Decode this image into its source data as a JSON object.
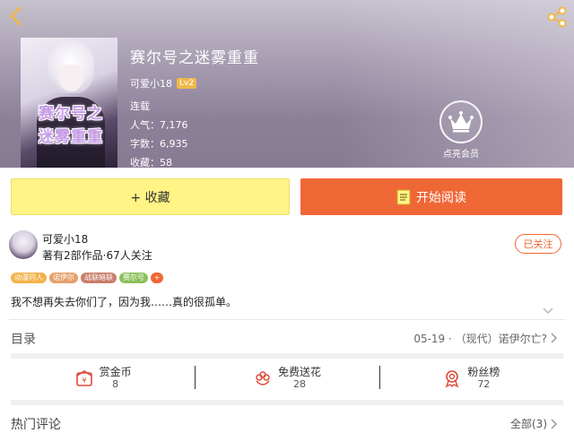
{
  "book": {
    "title": "赛尔号之迷雾重重",
    "cover_text_line1": "赛尔号之",
    "cover_text_line2": "迷雾重重",
    "author": "可爱小18",
    "level": "Lv2",
    "status": "连载",
    "popularity_label": "人气：",
    "popularity": "7,176",
    "words_label": "字数：",
    "words": "6,935",
    "favorites_label": "收藏：",
    "favorites": "58"
  },
  "vip": {
    "label": "点亮会员"
  },
  "actions": {
    "collect_label": "+ 收藏",
    "read_label": "开始阅读"
  },
  "author_panel": {
    "name": "可爱小18",
    "meta": "著有2部作品·67人关注",
    "follow_label": "已关注"
  },
  "tags": [
    {
      "label": "动漫同人",
      "color": "#f3b24a"
    },
    {
      "label": "诺伊尔",
      "color": "#e5a06a"
    },
    {
      "label": "战联暗联",
      "color": "#c97d6a"
    },
    {
      "label": "赛尔号",
      "color": "#8cc15a"
    },
    {
      "label": "+",
      "color": "#f06736"
    }
  ],
  "description": "我不想再失去你们了，因为我……真的很孤单。",
  "catalog": {
    "title": "目录",
    "latest": "05-19 · （现代）诺伊尔亡?"
  },
  "rewards": [
    {
      "icon": "coin-icon",
      "label": "赏金币",
      "value": "8"
    },
    {
      "icon": "flower-icon",
      "label": "免费送花",
      "value": "28"
    },
    {
      "icon": "medal-icon",
      "label": "粉丝榜",
      "value": "72"
    }
  ],
  "comments": {
    "title": "热门评论",
    "all_label": "全部(3)"
  },
  "colors": {
    "accent": "#f06736",
    "collect": "#fff485",
    "level": "#f0b84a"
  }
}
